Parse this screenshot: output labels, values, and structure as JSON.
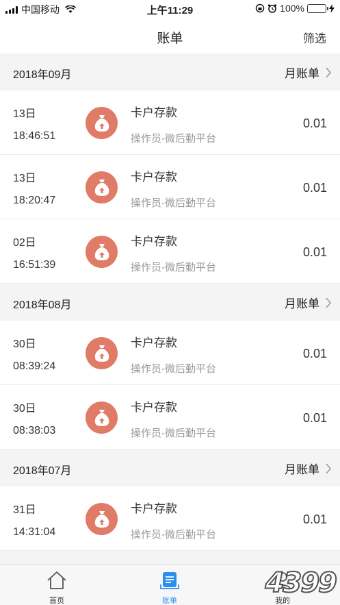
{
  "status_bar": {
    "carrier": "中国移动",
    "time": "上午11:29",
    "battery": "100%"
  },
  "nav": {
    "title": "账单",
    "filter": "筛选"
  },
  "sections": [
    {
      "month": "2018年09月",
      "link": "月账单",
      "rows": [
        {
          "day": "13日",
          "time": "18:46:51",
          "title": "卡户存款",
          "sub": "操作员-微后勤平台",
          "amount": "0.01"
        },
        {
          "day": "13日",
          "time": "18:20:47",
          "title": "卡户存款",
          "sub": "操作员-微后勤平台",
          "amount": "0.01"
        },
        {
          "day": "02日",
          "time": "16:51:39",
          "title": "卡户存款",
          "sub": "操作员-微后勤平台",
          "amount": "0.01"
        }
      ]
    },
    {
      "month": "2018年08月",
      "link": "月账单",
      "rows": [
        {
          "day": "30日",
          "time": "08:39:24",
          "title": "卡户存款",
          "sub": "操作员-微后勤平台",
          "amount": "0.01"
        },
        {
          "day": "30日",
          "time": "08:38:03",
          "title": "卡户存款",
          "sub": "操作员-微后勤平台",
          "amount": "0.01"
        }
      ]
    },
    {
      "month": "2018年07月",
      "link": "月账单",
      "rows": [
        {
          "day": "31日",
          "time": "14:31:04",
          "title": "卡户存款",
          "sub": "操作员-微后勤平台",
          "amount": "0.01"
        }
      ]
    }
  ],
  "tabs": [
    {
      "label": "首页",
      "icon": "home-icon"
    },
    {
      "label": "账单",
      "icon": "bill-icon"
    },
    {
      "label": "我的",
      "icon": "user-icon"
    }
  ],
  "watermark": "4399",
  "colors": {
    "accent": "#2d8ef0",
    "icon_bg": "#e07b67",
    "battery": "#4cd964"
  }
}
